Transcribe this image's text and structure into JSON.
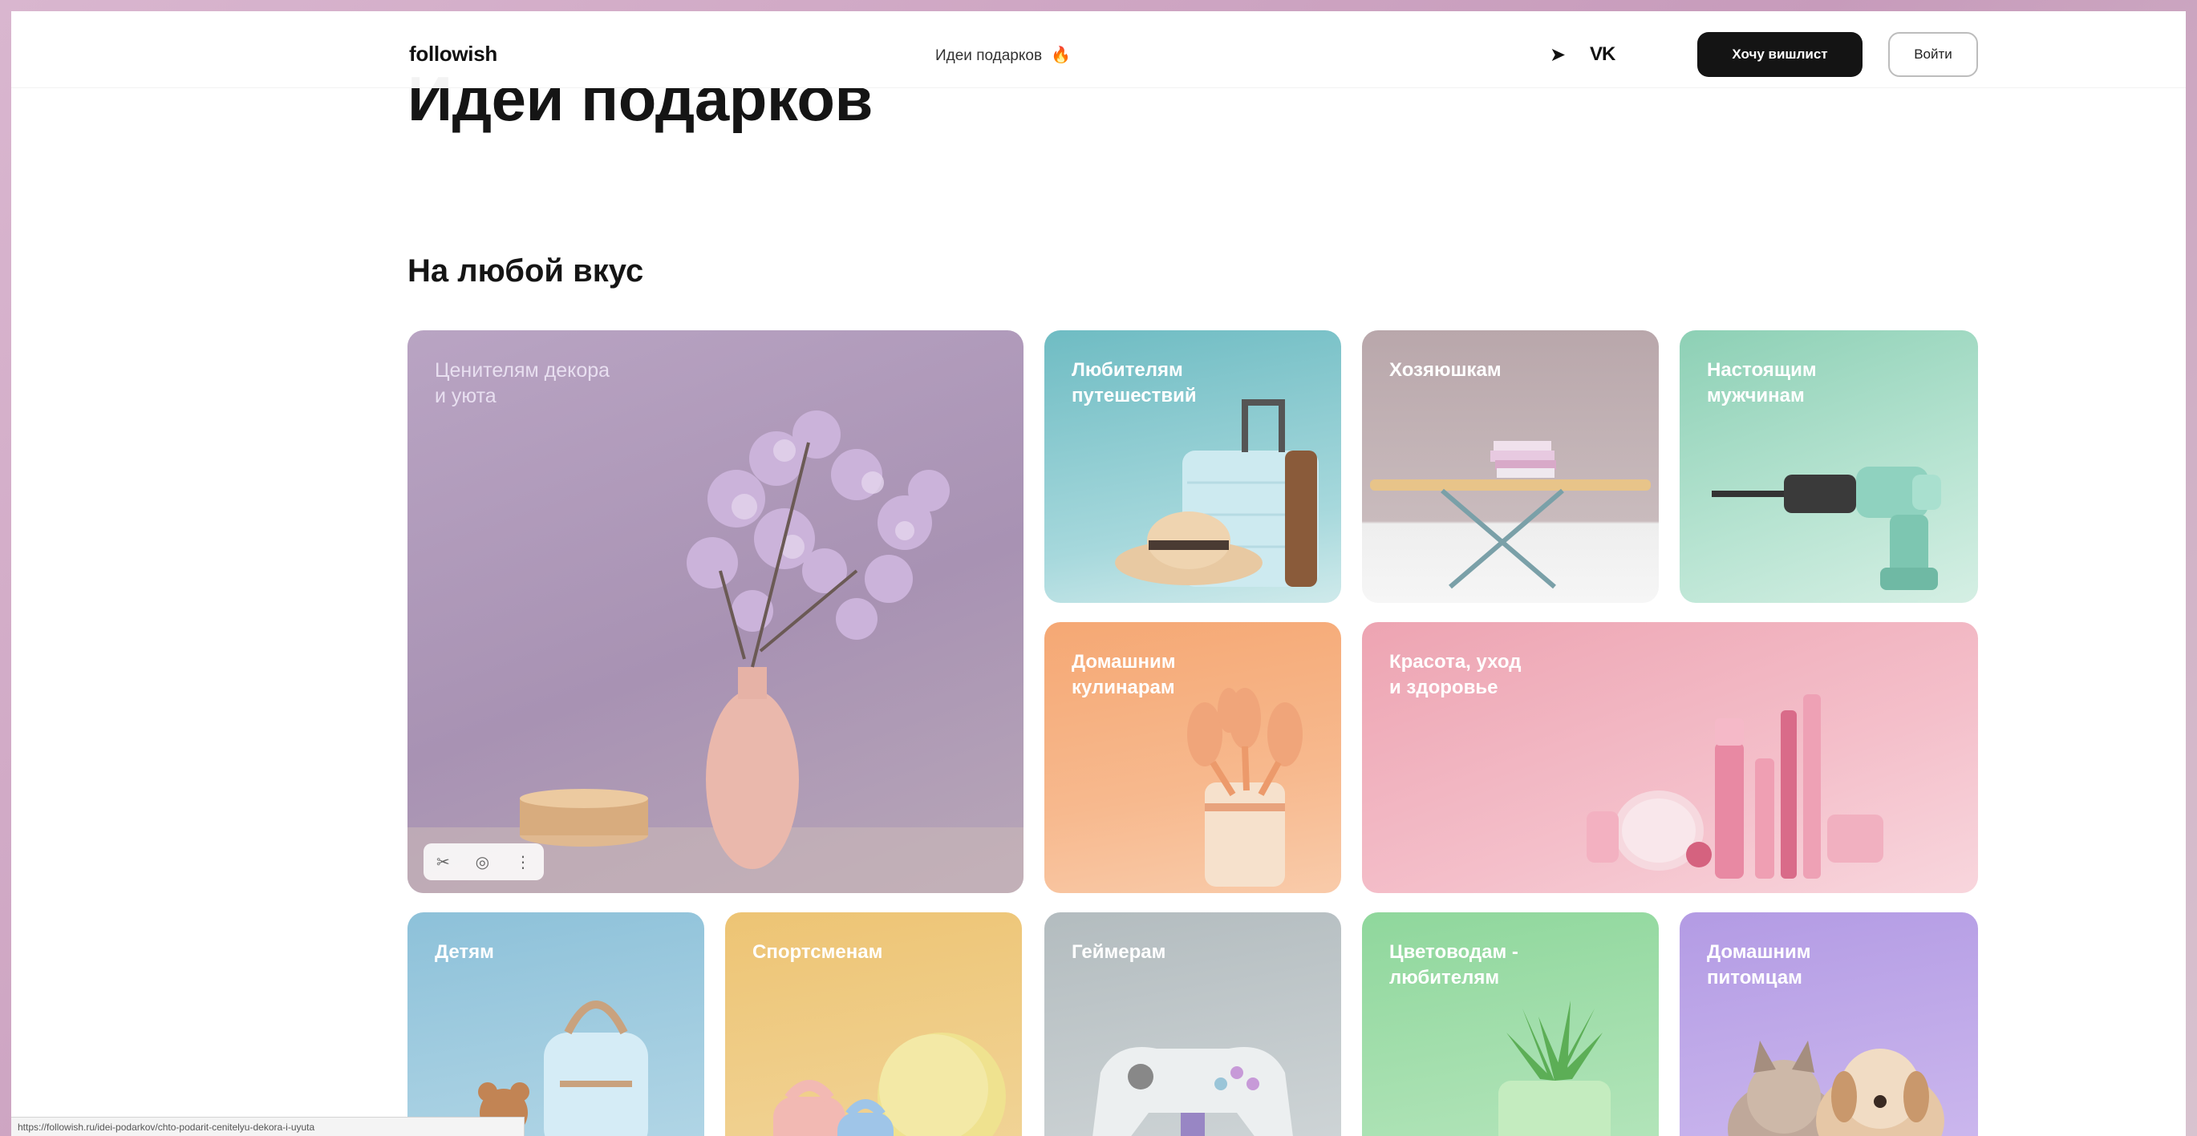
{
  "header": {
    "logo": "followish",
    "nav_ideas": "Идеи подарков",
    "nav_ideas_emoji": "🔥",
    "telegram_icon": "➤",
    "vk_icon": "VK",
    "wishlist_button": "Хочу вишлист",
    "login_button": "Войти"
  },
  "page_title": "Идеи подарков",
  "section_title": "На любой вкус",
  "cards": {
    "decor": "Ценителям декора\nи уюта",
    "travel": "Любителям\nпутешествий",
    "host": "Хозяюшкам",
    "men": "Настоящим\nмужчинам",
    "cook": "Домашним\nкулинарам",
    "beauty": "Красота, уход\nи здоровье",
    "kids": "Детям",
    "sport": "Спортсменам",
    "gamer": "Геймерам",
    "flower": "Цветоводам -\nлюбителям",
    "pets": "Домашним\nпитомцам"
  },
  "image_toolbar": {
    "icon1": "✂",
    "icon2": "◎",
    "icon3": "⋮"
  },
  "status_bar_url": "https://followish.ru/idei-podarkov/chto-podarit-cenitelyu-dekora-i-uyuta"
}
